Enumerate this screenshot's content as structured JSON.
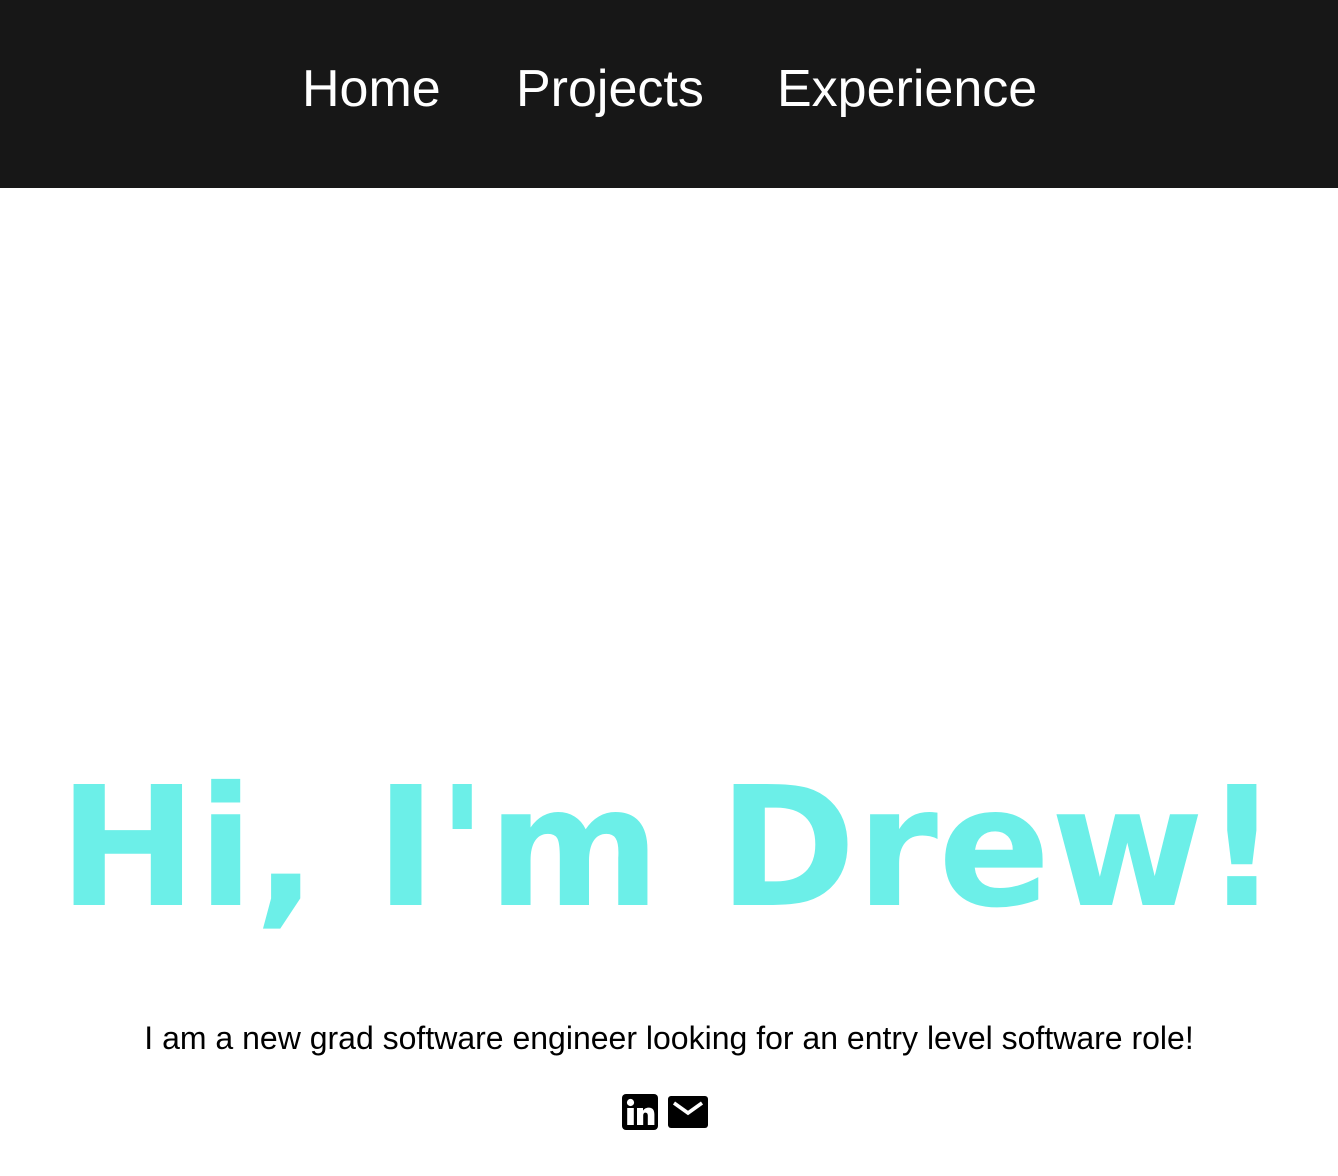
{
  "nav": {
    "items": [
      {
        "label": "Home"
      },
      {
        "label": "Projects"
      },
      {
        "label": "Experience"
      }
    ]
  },
  "hero": {
    "title": "Hi, I'm Drew!",
    "subtitle": "I am a new grad software engineer looking for an entry level software role!"
  },
  "social": {
    "icons": [
      "linkedin-icon",
      "email-icon"
    ]
  },
  "colors": {
    "nav_background": "#171717",
    "nav_text": "#ffffff",
    "accent": "#6cefe8",
    "body_text": "#000000",
    "background": "#ffffff"
  }
}
